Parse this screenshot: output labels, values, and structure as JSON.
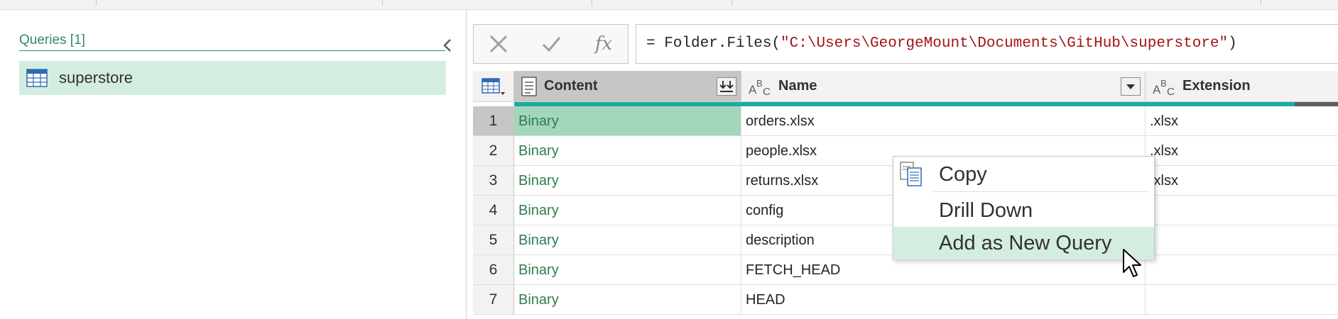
{
  "queries_pane": {
    "header": "Queries [1]",
    "items": [
      {
        "label": "superstore"
      }
    ]
  },
  "formula_bar": {
    "fx_label": "fx",
    "formula_prefix": "= Folder.Files(",
    "formula_string": "\"C:\\Users\\GeorgeMount\\Documents\\GitHub\\superstore\"",
    "formula_suffix": ")"
  },
  "grid": {
    "columns": [
      {
        "name": "Content",
        "type_icon": "binary-type-icon"
      },
      {
        "name": "Name",
        "type_icon": "text-type-icon"
      },
      {
        "name": "Extension",
        "type_icon": "text-type-icon"
      }
    ],
    "rows": [
      {
        "num": "1",
        "content": "Binary",
        "name": "orders.xlsx",
        "extension": ".xlsx"
      },
      {
        "num": "2",
        "content": "Binary",
        "name": "people.xlsx",
        "extension": ".xlsx"
      },
      {
        "num": "3",
        "content": "Binary",
        "name": "returns.xlsx",
        "extension": ".xlsx"
      },
      {
        "num": "4",
        "content": "Binary",
        "name": "config",
        "extension": ""
      },
      {
        "num": "5",
        "content": "Binary",
        "name": "description",
        "extension": ""
      },
      {
        "num": "6",
        "content": "Binary",
        "name": "FETCH_HEAD",
        "extension": ""
      },
      {
        "num": "7",
        "content": "Binary",
        "name": "HEAD",
        "extension": ""
      }
    ]
  },
  "context_menu": {
    "items": [
      {
        "label": "Copy",
        "icon": "copy-icon"
      },
      {
        "label": "Drill Down"
      },
      {
        "label": "Add as New Query"
      }
    ]
  },
  "colors": {
    "accent_green": "#2e8c6a",
    "selected_row_bg": "#d3eee1",
    "selected_cell_bg": "#a3d6bd",
    "quality_bar": "#1aaca0",
    "string_red": "#a31515"
  }
}
